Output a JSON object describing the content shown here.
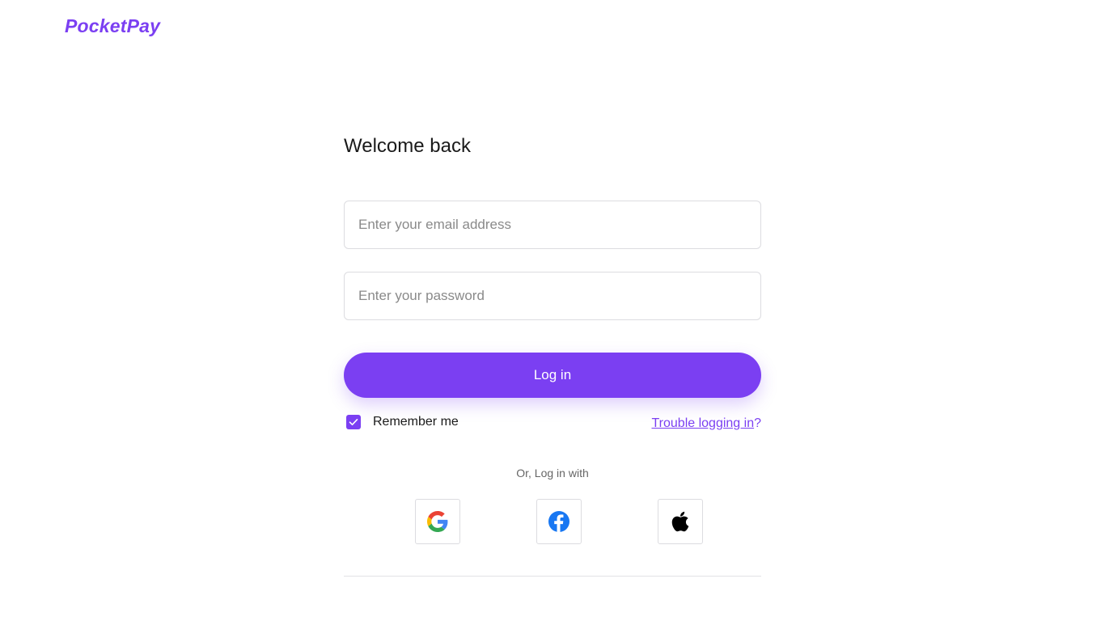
{
  "brand": {
    "logo_text": "PocketPay",
    "accent_color": "#7b3ff2"
  },
  "login": {
    "title": "Welcome back",
    "email_placeholder": "Enter your email address",
    "password_placeholder": "Enter your password",
    "login_button": "Log in",
    "remember_me_label": "Remember me",
    "remember_me_checked": true,
    "trouble_link": "Trouble logging in",
    "trouble_suffix": "?",
    "social_prompt": "Or, Log in with",
    "social_providers": [
      {
        "name": "Google",
        "icon": "google-icon"
      },
      {
        "name": "Facebook",
        "icon": "facebook-icon"
      },
      {
        "name": "Apple",
        "icon": "apple-icon"
      }
    ]
  }
}
